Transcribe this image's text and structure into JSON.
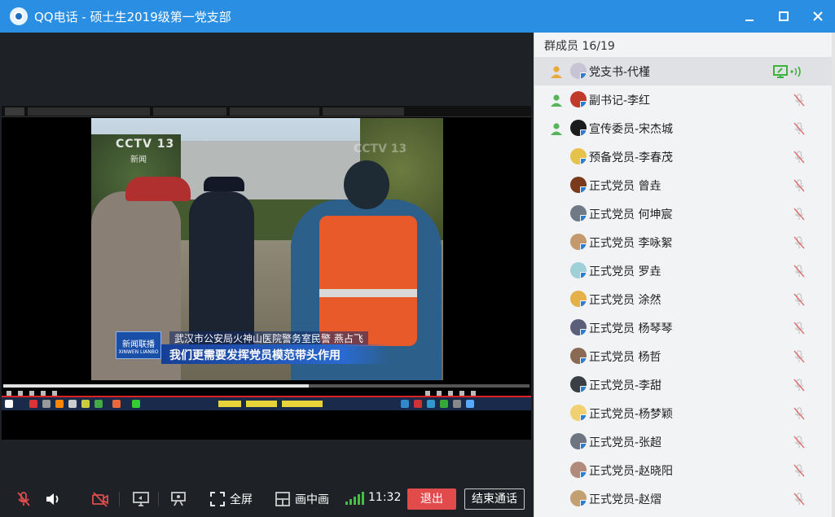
{
  "window": {
    "title": "QQ电话 - 硕士生2019级第一党支部"
  },
  "video": {
    "channel_logo": "CCTV 13",
    "channel_sub": "新闻",
    "watermark": "CCTV 13",
    "news_badge": "新闻联播",
    "news_badge_sub": "XINWEN LIANBO",
    "caption_name": "武汉市公安局火神山医院警务室民警  燕占飞",
    "caption_quote": "我们更需要发挥党员模范带头作用",
    "progress": 0.58
  },
  "toolbar": {
    "fullscreen_label": "全屏",
    "pip_label": "画中画",
    "time": "11:32",
    "exit_label": "退出",
    "end_call_label": "结束通话"
  },
  "members": {
    "header": "群成员 16/19",
    "items": [
      {
        "name": "党支书-代槿",
        "host": true,
        "sharing": true,
        "active": true,
        "avatar_color": "#c9c3d6"
      },
      {
        "name": "副书记-李红",
        "host": true,
        "sharing": false,
        "active": false,
        "avatar_color": "#c0392b"
      },
      {
        "name": "宣传委员-宋杰城",
        "host": true,
        "sharing": false,
        "active": false,
        "avatar_color": "#1b1b1b"
      },
      {
        "name": "预备党员-李春茂",
        "host": false,
        "sharing": false,
        "active": false,
        "avatar_color": "#e5c34b"
      },
      {
        "name": "正式党员 曾垚",
        "host": false,
        "sharing": false,
        "active": false,
        "avatar_color": "#7a3b1c"
      },
      {
        "name": "正式党员 何坤宸",
        "host": false,
        "sharing": false,
        "active": false,
        "avatar_color": "#6f7a86"
      },
      {
        "name": "正式党员 李咏絮",
        "host": false,
        "sharing": false,
        "active": false,
        "avatar_color": "#c49a6c"
      },
      {
        "name": "正式党员 罗垚",
        "host": false,
        "sharing": false,
        "active": false,
        "avatar_color": "#9fd0d8"
      },
      {
        "name": "正式党员 涂然",
        "host": false,
        "sharing": false,
        "active": false,
        "avatar_color": "#e3b04a"
      },
      {
        "name": "正式党员 杨琴琴",
        "host": false,
        "sharing": false,
        "active": false,
        "avatar_color": "#5a5f7a"
      },
      {
        "name": "正式党员 杨哲",
        "host": false,
        "sharing": false,
        "active": false,
        "avatar_color": "#8a6a52"
      },
      {
        "name": "正式党员-李甜",
        "host": false,
        "sharing": false,
        "active": false,
        "avatar_color": "#3a3f45"
      },
      {
        "name": "正式党员-杨梦颖",
        "host": false,
        "sharing": false,
        "active": false,
        "avatar_color": "#f0d070"
      },
      {
        "name": "正式党员-张超",
        "host": false,
        "sharing": false,
        "active": false,
        "avatar_color": "#6d7580"
      },
      {
        "name": "正式党员-赵晓阳",
        "host": false,
        "sharing": false,
        "active": false,
        "avatar_color": "#b08a7a"
      },
      {
        "name": "正式党员-赵熠",
        "host": false,
        "sharing": false,
        "active": false,
        "avatar_color": "#c2a070"
      }
    ]
  },
  "colors": {
    "titlebar": "#2a8ee3",
    "exit_button": "#e24b4b",
    "signal": "#3fc23f",
    "sharing": "#3db33d",
    "muted_mic": "#c9c9c9"
  }
}
